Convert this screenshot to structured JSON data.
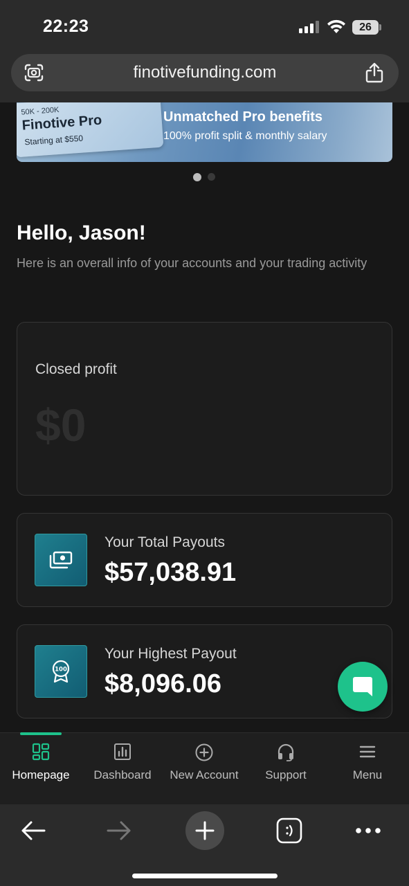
{
  "status_bar": {
    "time": "22:23",
    "battery": "26"
  },
  "browser": {
    "url": "finotivefunding.com"
  },
  "banner": {
    "card_range": "50K - 200K",
    "card_title": "Finotive Pro",
    "card_price": "Starting at $550",
    "headline": "Unmatched Pro benefits",
    "subline": "100% profit split & monthly salary",
    "dots": {
      "count": 2,
      "active": 0,
      "active_color": "#bdbdbd",
      "inactive_color": "#3a3a3a"
    }
  },
  "greeting": {
    "title": "Hello, Jason!",
    "subtitle": "Here is an overall info of your accounts and your trading activity"
  },
  "closed_profit": {
    "label": "Closed profit",
    "value": "$0"
  },
  "payouts": {
    "total": {
      "label": "Your Total Payouts",
      "value": "$57,038.91",
      "icon": "money-icon"
    },
    "highest": {
      "label": "Your Highest Payout",
      "value": "$8,096.06",
      "icon": "badge-100-icon"
    }
  },
  "app_nav": {
    "items": [
      {
        "label": "Homepage",
        "icon": "grid-icon",
        "active": true
      },
      {
        "label": "Dashboard",
        "icon": "bar-chart-icon"
      },
      {
        "label": "New Account",
        "icon": "plus-circle-icon"
      },
      {
        "label": "Support",
        "icon": "headset-icon"
      },
      {
        "label": "Menu",
        "icon": "hamburger-icon"
      }
    ]
  },
  "colors": {
    "accent": "#1ec28b",
    "background": "#171717",
    "card": "#1c1c1c",
    "icon_tile": "#1f7f8e"
  }
}
